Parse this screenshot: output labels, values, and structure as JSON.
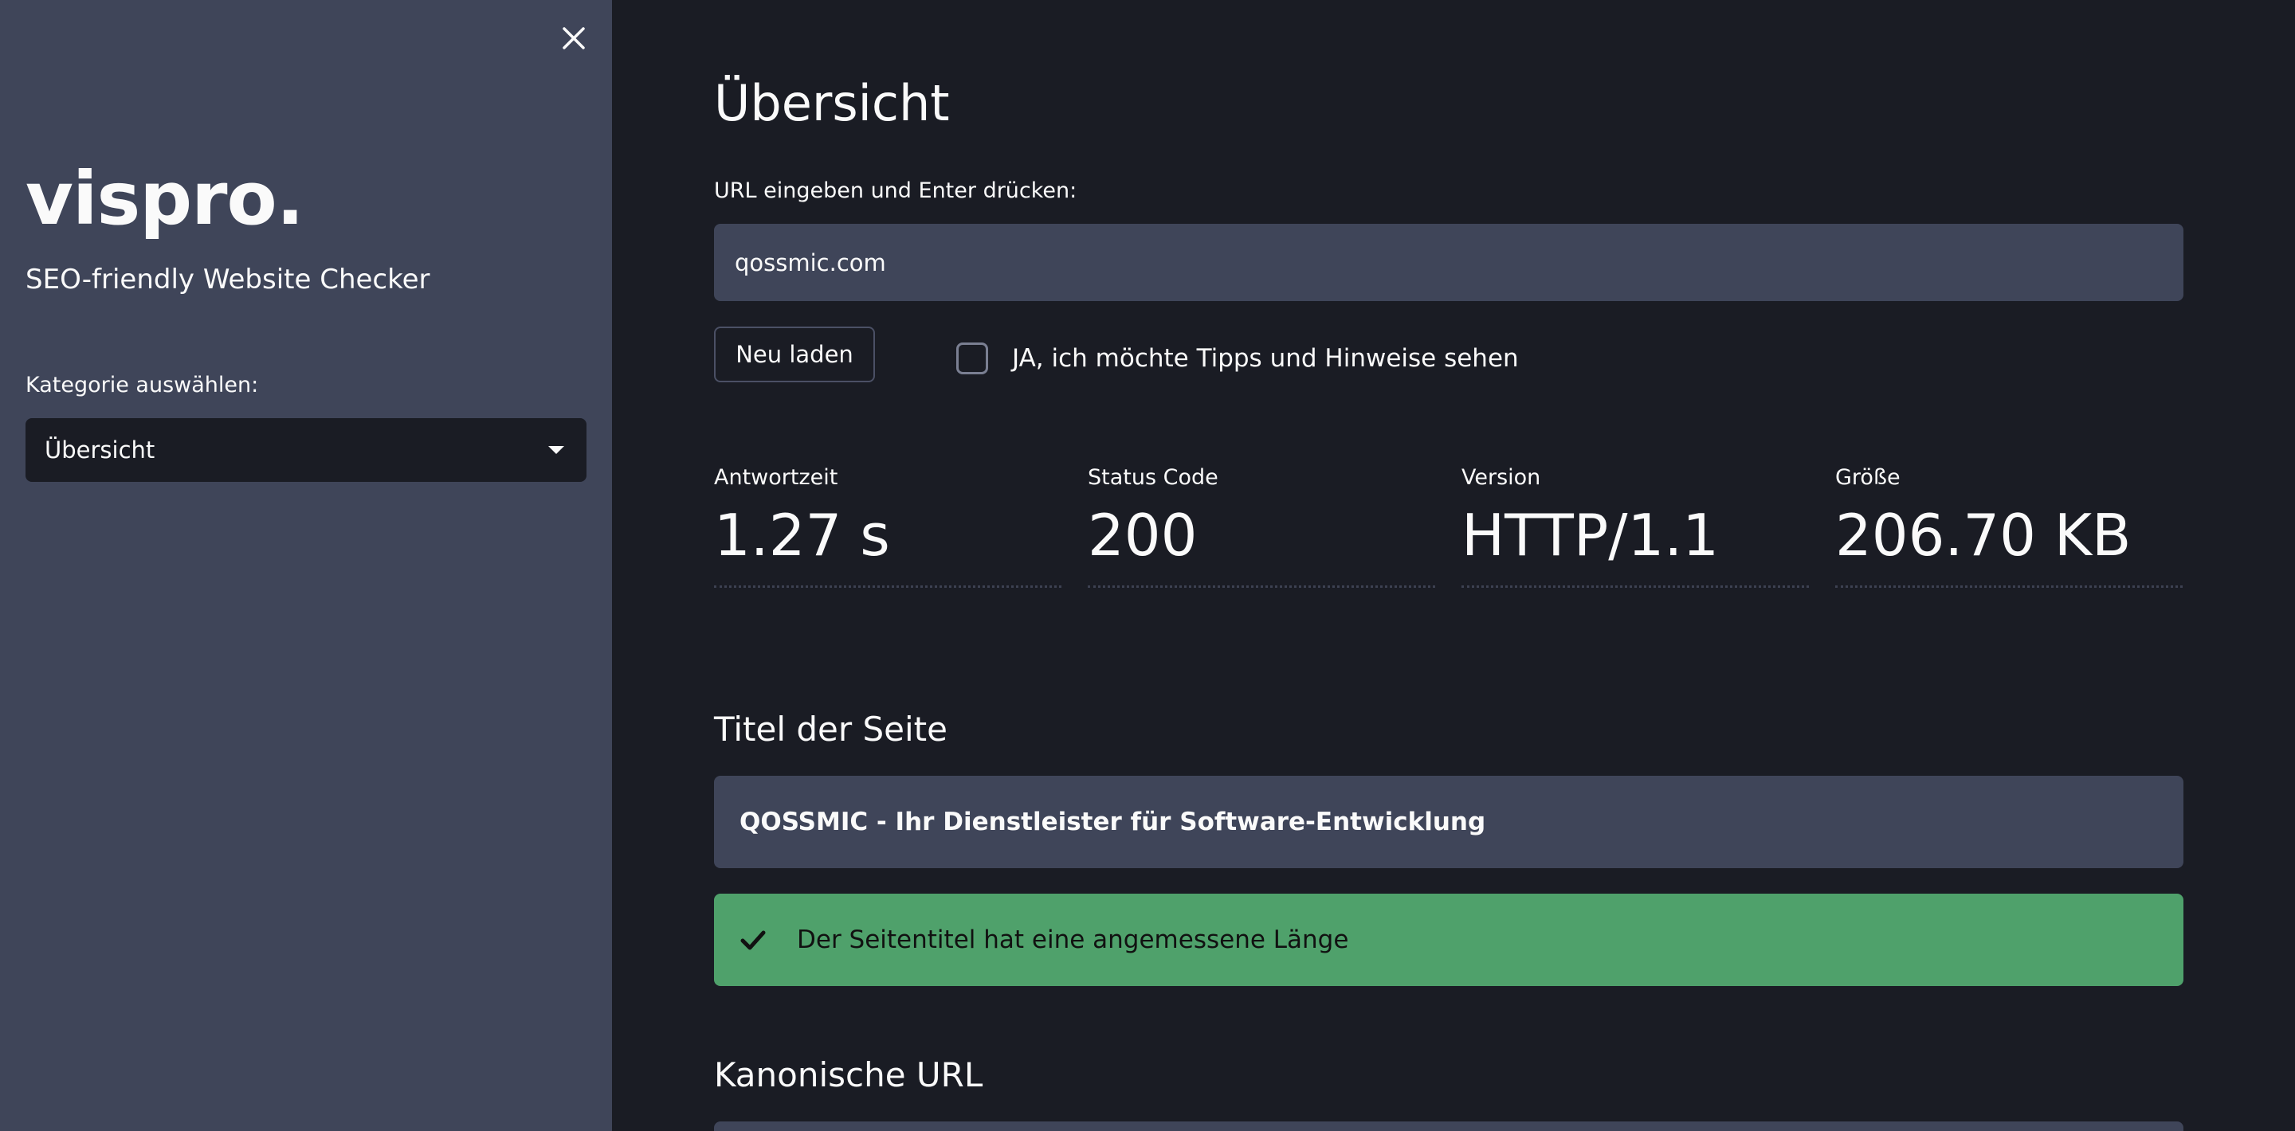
{
  "sidebar": {
    "brand": "vispro.",
    "tagline": "SEO-friendly Website Checker",
    "category_label": "Kategorie auswählen:",
    "category_selected": "Übersicht",
    "close_icon": "close-icon"
  },
  "main": {
    "title": "Übersicht",
    "url_label": "URL eingeben und Enter drücken:",
    "url_value": "qossmic.com",
    "reload_label": "Neu laden",
    "tips_label": "JA, ich möchte Tipps und Hinweise sehen",
    "tips_checked": false,
    "metrics": [
      {
        "label": "Antwortzeit",
        "value": "1.27 s"
      },
      {
        "label": "Status Code",
        "value": "200"
      },
      {
        "label": "Version",
        "value": "HTTP/1.1"
      },
      {
        "label": "Größe",
        "value": "206.70 KB"
      }
    ],
    "page_title_heading": "Titel der Seite",
    "page_title_value": "QOSSMIC - Ihr Dienstleister für Software-Entwicklung",
    "page_title_status": "Der Seitentitel hat eine angemessene Länge",
    "canonical_heading": "Kanonische URL"
  },
  "colors": {
    "sidebar_bg": "#3f4559",
    "main_bg": "#1a1c24",
    "success": "#4fa16b"
  }
}
